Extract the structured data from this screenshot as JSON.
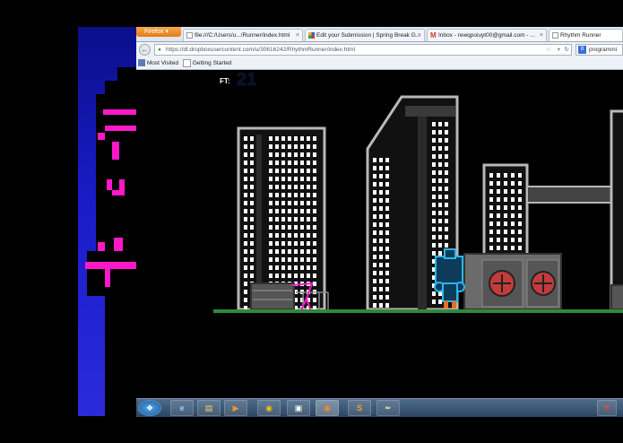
{
  "browser": {
    "firefox_label": "Firefox",
    "tabs": [
      {
        "label": "file:///C:/Users/u.../Runner/index.html"
      },
      {
        "label": "Edit your Submission | Spring Break G..."
      },
      {
        "label": "Inbox - rewqpoiuyt00@gmail.com - ..."
      },
      {
        "label": "Rhythm Runner"
      }
    ],
    "url": "https://dl.dropboxusercontent.com/u/30616242/RhythmRunner/index.html",
    "search_text": "programmi",
    "bookmarks": [
      "Most Visited",
      "Getting Started"
    ]
  },
  "game": {
    "score_label": "FT:",
    "score_value": "21"
  },
  "colors": {
    "gem_green": "#2bd14a",
    "runner_magenta": "#ff18c8",
    "ground_green": "#2f8a3b",
    "taskbar": "#3a5675"
  }
}
